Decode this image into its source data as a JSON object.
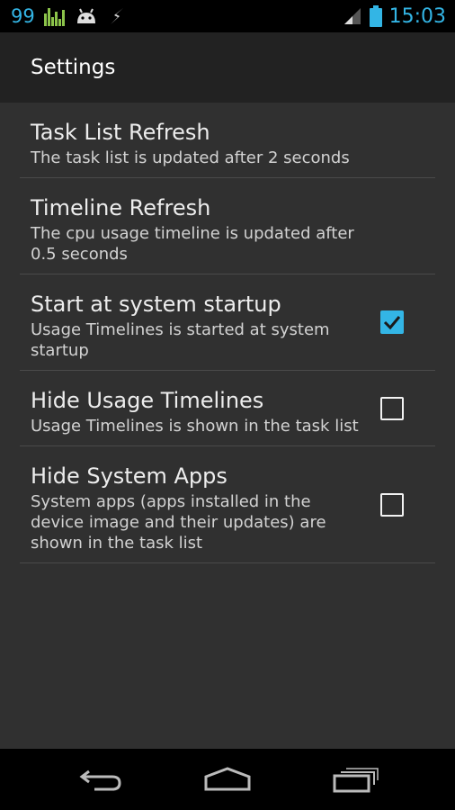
{
  "status_bar": {
    "battery_level": "99",
    "time": "15:03",
    "accent_color": "#33b5e5",
    "icons": [
      "cpu-bars-icon",
      "android-icon",
      "usb-debug-icon",
      "signal-icon",
      "battery-icon"
    ]
  },
  "action_bar": {
    "title": "Settings"
  },
  "preferences": [
    {
      "title": "Task List Refresh",
      "summary": "The task list is updated after 2 seconds",
      "checkbox": null
    },
    {
      "title": "Timeline Refresh",
      "summary": "The cpu usage timeline is updated after 0.5 seconds",
      "checkbox": null
    },
    {
      "title": "Start at system startup",
      "summary": "Usage Timelines is started at system startup",
      "checkbox": true
    },
    {
      "title": "Hide Usage Timelines",
      "summary": "Usage Timelines is shown in the task list",
      "checkbox": false
    },
    {
      "title": "Hide System Apps",
      "summary": "System apps (apps installed in the device image and their updates) are shown in the task list",
      "checkbox": false
    }
  ],
  "nav_bar": {
    "icons": [
      "back-icon",
      "home-icon",
      "recent-apps-icon"
    ]
  }
}
